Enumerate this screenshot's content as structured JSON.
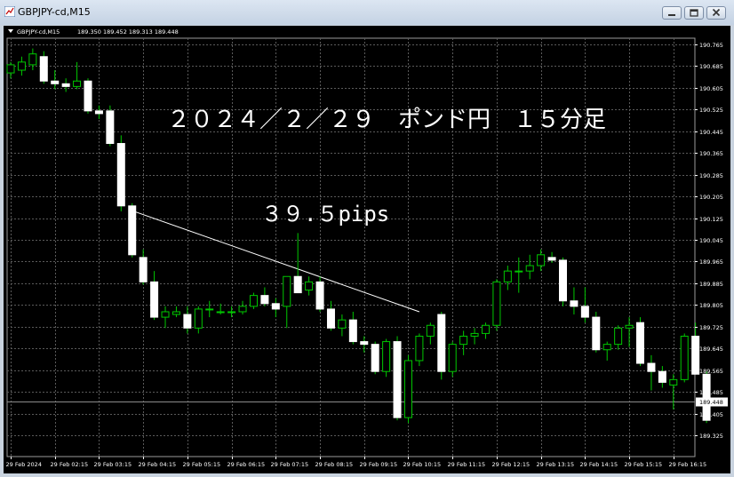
{
  "window": {
    "title": "GBPJPY-cd,M15"
  },
  "chart_header": {
    "symbol_label": "GBPJPY-cd,M15",
    "ohlc": "189.350 189.452 189.313 189.448"
  },
  "annotations": {
    "title": "２０２４／２／２９　ポンド円　１５分足",
    "pips": "３９.５pips"
  },
  "colors": {
    "background": "#000000",
    "grid": "#5a5a5a",
    "bull_body": "#000000",
    "bull_outline": "#00c800",
    "bear_body": "#ffffff",
    "bear_outline": "#ffffff",
    "wick": "#00c800",
    "text": "#ffffff",
    "current_price_bg": "#ffffff"
  },
  "chart_data": {
    "type": "candlestick",
    "y_ticks": [
      "190.765",
      "190.685",
      "190.605",
      "190.525",
      "190.445",
      "190.365",
      "190.285",
      "190.205",
      "190.125",
      "190.045",
      "189.965",
      "189.885",
      "189.805",
      "189.725",
      "189.645",
      "189.565",
      "189.485",
      "189.405",
      "189.325"
    ],
    "ylim": [
      189.325,
      190.765
    ],
    "current_price": "189.448",
    "x_ticks": [
      "29 Feb 2024",
      "29 Feb 02:15",
      "29 Feb 03:15",
      "29 Feb 04:15",
      "29 Feb 05:15",
      "29 Feb 06:15",
      "29 Feb 07:15",
      "29 Feb 08:15",
      "29 Feb 09:15",
      "29 Feb 10:15",
      "29 Feb 11:15",
      "29 Feb 12:15",
      "29 Feb 13:15",
      "29 Feb 14:15",
      "29 Feb 15:15",
      "29 Feb 16:15"
    ],
    "candles": [
      [
        190.66,
        190.7,
        190.64,
        190.69
      ],
      [
        190.67,
        190.72,
        190.65,
        190.7
      ],
      [
        190.69,
        190.75,
        190.67,
        190.73
      ],
      [
        190.72,
        190.74,
        190.62,
        190.63
      ],
      [
        190.63,
        190.67,
        190.6,
        190.62
      ],
      [
        190.62,
        190.64,
        190.59,
        190.61
      ],
      [
        190.61,
        190.7,
        190.6,
        190.63
      ],
      [
        190.63,
        190.64,
        190.51,
        190.52
      ],
      [
        190.52,
        190.54,
        190.49,
        190.51
      ],
      [
        190.52,
        190.54,
        190.39,
        190.4
      ],
      [
        190.4,
        190.43,
        190.15,
        190.17
      ],
      [
        190.17,
        190.18,
        189.98,
        189.99
      ],
      [
        189.98,
        190.01,
        189.88,
        189.89
      ],
      [
        189.89,
        189.93,
        189.75,
        189.76
      ],
      [
        189.76,
        189.8,
        189.72,
        189.78
      ],
      [
        189.77,
        189.8,
        189.76,
        189.78
      ],
      [
        189.77,
        189.8,
        189.7,
        189.72
      ],
      [
        189.72,
        189.8,
        189.7,
        189.79
      ],
      [
        189.79,
        189.82,
        189.76,
        189.79
      ],
      [
        189.78,
        189.81,
        189.77,
        189.78
      ],
      [
        189.78,
        189.8,
        189.76,
        189.78
      ],
      [
        189.78,
        189.82,
        189.77,
        189.8
      ],
      [
        189.8,
        189.85,
        189.79,
        189.84
      ],
      [
        189.84,
        189.87,
        189.8,
        189.81
      ],
      [
        189.81,
        189.83,
        189.76,
        189.79
      ],
      [
        189.8,
        189.91,
        189.72,
        189.91
      ],
      [
        189.91,
        190.07,
        189.86,
        189.85
      ],
      [
        189.86,
        189.91,
        189.84,
        189.89
      ],
      [
        189.89,
        189.91,
        189.78,
        189.79
      ],
      [
        189.79,
        189.82,
        189.71,
        189.72
      ],
      [
        189.72,
        189.77,
        189.69,
        189.75
      ],
      [
        189.75,
        189.78,
        189.66,
        189.67
      ],
      [
        189.67,
        189.69,
        189.63,
        189.66
      ],
      [
        189.66,
        189.67,
        189.55,
        189.56
      ],
      [
        189.56,
        189.68,
        189.54,
        189.67
      ],
      [
        189.67,
        189.69,
        189.38,
        189.39
      ],
      [
        189.39,
        189.62,
        189.37,
        189.6
      ],
      [
        189.6,
        189.7,
        189.58,
        189.69
      ],
      [
        189.69,
        189.74,
        189.66,
        189.73
      ],
      [
        189.77,
        189.78,
        189.53,
        189.56
      ],
      [
        189.56,
        189.67,
        189.54,
        189.66
      ],
      [
        189.66,
        189.71,
        189.62,
        189.69
      ],
      [
        189.69,
        189.72,
        189.66,
        189.7
      ],
      [
        189.7,
        189.74,
        189.68,
        189.73
      ],
      [
        189.73,
        189.9,
        189.71,
        189.89
      ],
      [
        189.89,
        189.95,
        189.86,
        189.93
      ],
      [
        189.93,
        189.98,
        189.85,
        189.93
      ],
      [
        189.93,
        189.99,
        189.9,
        189.95
      ],
      [
        189.95,
        190.01,
        189.93,
        189.99
      ],
      [
        189.98,
        190.0,
        189.96,
        189.97
      ],
      [
        189.97,
        189.98,
        189.8,
        189.82
      ],
      [
        189.82,
        189.87,
        189.77,
        189.8
      ],
      [
        189.8,
        189.87,
        189.74,
        189.76
      ],
      [
        189.76,
        189.78,
        189.63,
        189.64
      ],
      [
        189.64,
        189.67,
        189.6,
        189.66
      ],
      [
        189.66,
        189.73,
        189.64,
        189.72
      ],
      [
        189.72,
        189.76,
        189.65,
        189.73
      ],
      [
        189.74,
        189.76,
        189.58,
        189.59
      ],
      [
        189.59,
        189.62,
        189.49,
        189.56
      ],
      [
        189.56,
        189.58,
        189.5,
        189.52
      ],
      [
        189.51,
        189.55,
        189.42,
        189.53
      ],
      [
        189.53,
        189.7,
        189.52,
        189.69
      ],
      [
        189.69,
        189.74,
        189.63,
        189.55
      ],
      [
        189.55,
        189.56,
        189.37,
        189.38
      ]
    ],
    "trendline": {
      "from": [
        11,
        190.15
      ],
      "to": [
        37,
        189.78
      ]
    }
  }
}
